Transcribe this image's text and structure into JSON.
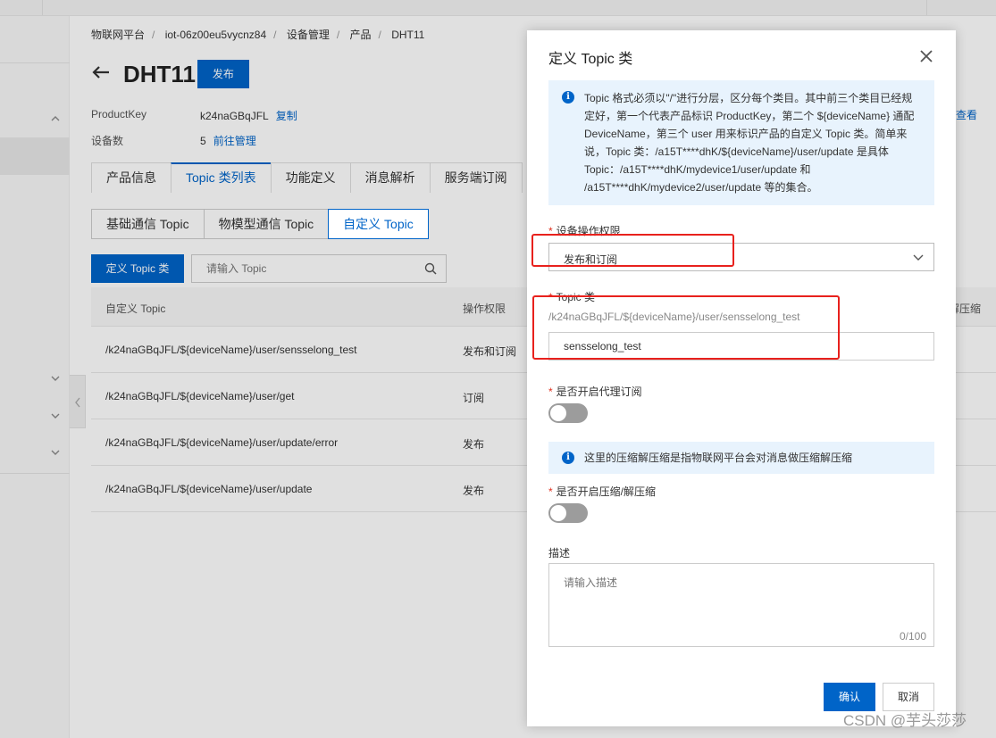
{
  "breadcrumb": {
    "items": [
      "物联网平台",
      "iot-06z00eu5vycnz84",
      "设备管理",
      "产品",
      "DHT11"
    ],
    "separator": "/"
  },
  "product": {
    "title": "DHT11",
    "publish_label": "发布",
    "productkey_label": "ProductKey",
    "productkey_value": "k24naGBqJFL",
    "copy_label": "复制",
    "device_count_label": "设备数",
    "device_count_value": "5",
    "manage_label": "前往管理",
    "right_stars": "**",
    "right_view_label": "查看"
  },
  "tabs": [
    "产品信息",
    "Topic 类列表",
    "功能定义",
    "消息解析",
    "服务端订阅"
  ],
  "active_tab": 1,
  "subtabs": [
    "基础通信 Topic",
    "物模型通信 Topic",
    "自定义 Topic"
  ],
  "active_subtab": 2,
  "toolbar": {
    "define_label": "定义 Topic 类",
    "search_placeholder": "请输入 Topic"
  },
  "table": {
    "headers": {
      "topic": "自定义 Topic",
      "permission": "操作权限",
      "compress": "解压缩"
    },
    "rows": [
      {
        "topic": "/k24naGBqJFL/${deviceName}/user/sensselong_test",
        "permission": "发布和订阅"
      },
      {
        "topic": "/k24naGBqJFL/${deviceName}/user/get",
        "permission": "订阅"
      },
      {
        "topic": "/k24naGBqJFL/${deviceName}/user/update/error",
        "permission": "发布"
      },
      {
        "topic": "/k24naGBqJFL/${deviceName}/user/update",
        "permission": "发布"
      }
    ]
  },
  "drawer": {
    "title": "定义 Topic 类",
    "info_text": "Topic 格式必须以\"/\"进行分层，区分每个类目。其中前三个类目已经规定好，第一个代表产品标识 ProductKey，第二个 ${deviceName} 通配 DeviceName，第三个 user 用来标识产品的自定义 Topic 类。简单来说，Topic 类：/a15T****dhK/${deviceName}/user/update 是具体 Topic：/a15T****dhK/mydevice1/user/update 和 /a15T****dhK/mydevice2/user/update 等的集合。",
    "permission_label": "设备操作权限",
    "permission_value": "发布和订阅",
    "topic_label": "Topic 类",
    "topic_prefix": "/k24naGBqJFL/${deviceName}/user/sensselong_test",
    "topic_value": "sensselong_test",
    "proxy_label": "是否开启代理订阅",
    "proxy_enabled": false,
    "compress_info": "这里的压缩解压缩是指物联网平台会对消息做压缩解压缩",
    "compress_label": "是否开启压缩/解压缩",
    "compress_enabled": false,
    "desc_label": "描述",
    "desc_placeholder": "请输入描述",
    "desc_counter": "0/100",
    "ok_label": "确认",
    "cancel_label": "取消"
  },
  "watermark": "CSDN @芋头莎莎",
  "colors": {
    "primary": "#0064c8",
    "highlight": "#e8211d",
    "info_bg": "#e8f3fd",
    "required": "#e0301e"
  }
}
